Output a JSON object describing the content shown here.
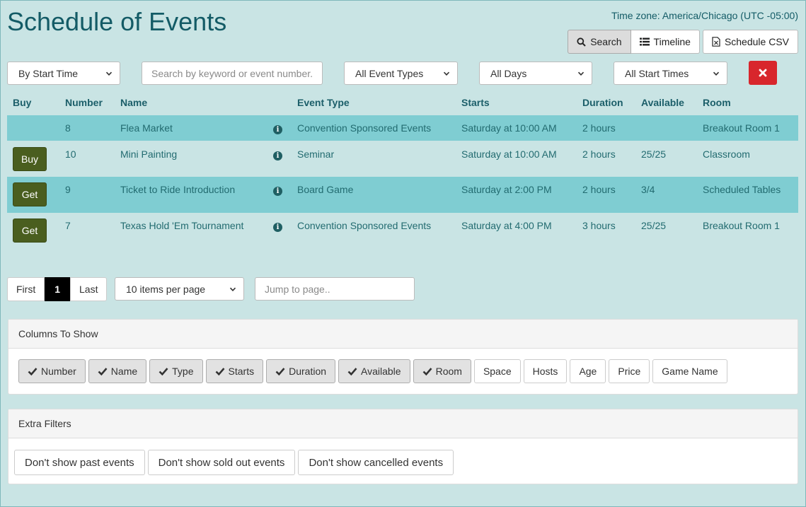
{
  "header": {
    "title": "Schedule of Events",
    "timezone": "Time zone: America/Chicago (UTC -05:00)",
    "view_buttons": [
      "Search",
      "Timeline",
      "Schedule CSV"
    ]
  },
  "filters": {
    "sort": "By Start Time",
    "search_placeholder": "Search by keyword or event number.",
    "event_types": "All Event Types",
    "days": "All Days",
    "start_times": "All Start Times"
  },
  "table": {
    "headers": [
      "Buy",
      "Number",
      "Name",
      "Event Type",
      "Starts",
      "Duration",
      "Available",
      "Room"
    ],
    "rows": [
      {
        "buy": "",
        "number": "8",
        "name": "Flea Market",
        "type": "Convention Sponsored Events",
        "starts": "Saturday at 10:00 AM",
        "duration": "2 hours",
        "available": "",
        "room": "Breakout Room 1"
      },
      {
        "buy": "Buy",
        "number": "10",
        "name": "Mini Painting",
        "type": "Seminar",
        "starts": "Saturday at 10:00 AM",
        "duration": "2 hours",
        "available": "25/25",
        "room": "Classroom"
      },
      {
        "buy": "Get",
        "number": "9",
        "name": "Ticket to Ride Introduction",
        "type": "Board Game",
        "starts": "Saturday at 2:00 PM",
        "duration": "2 hours",
        "available": "3/4",
        "room": "Scheduled Tables"
      },
      {
        "buy": "Get",
        "number": "7",
        "name": "Texas Hold 'Em Tournament",
        "type": "Convention Sponsored Events",
        "starts": "Saturday at 4:00 PM",
        "duration": "3 hours",
        "available": "25/25",
        "room": "Breakout Room 1"
      }
    ]
  },
  "pager": {
    "first": "First",
    "current": "1",
    "last": "Last",
    "per_page": "10 items per page",
    "jump_placeholder": "Jump to page.."
  },
  "columns_panel": {
    "title": "Columns To Show",
    "columns": [
      {
        "label": "Number",
        "on": true
      },
      {
        "label": "Name",
        "on": true
      },
      {
        "label": "Type",
        "on": true
      },
      {
        "label": "Starts",
        "on": true
      },
      {
        "label": "Duration",
        "on": true
      },
      {
        "label": "Available",
        "on": true
      },
      {
        "label": "Room",
        "on": true
      },
      {
        "label": "Space",
        "on": false
      },
      {
        "label": "Hosts",
        "on": false
      },
      {
        "label": "Age",
        "on": false
      },
      {
        "label": "Price",
        "on": false
      },
      {
        "label": "Game Name",
        "on": false
      }
    ]
  },
  "extra_filters": {
    "title": "Extra Filters",
    "buttons": [
      "Don't show past events",
      "Don't show sold out events",
      "Don't show cancelled events"
    ]
  },
  "colors": {
    "background": "#c9e4e4",
    "highlight_row": "#7fcdd2",
    "buy_button": "#4a5e1f",
    "clear_button": "#d8262c",
    "title": "#135b66"
  }
}
